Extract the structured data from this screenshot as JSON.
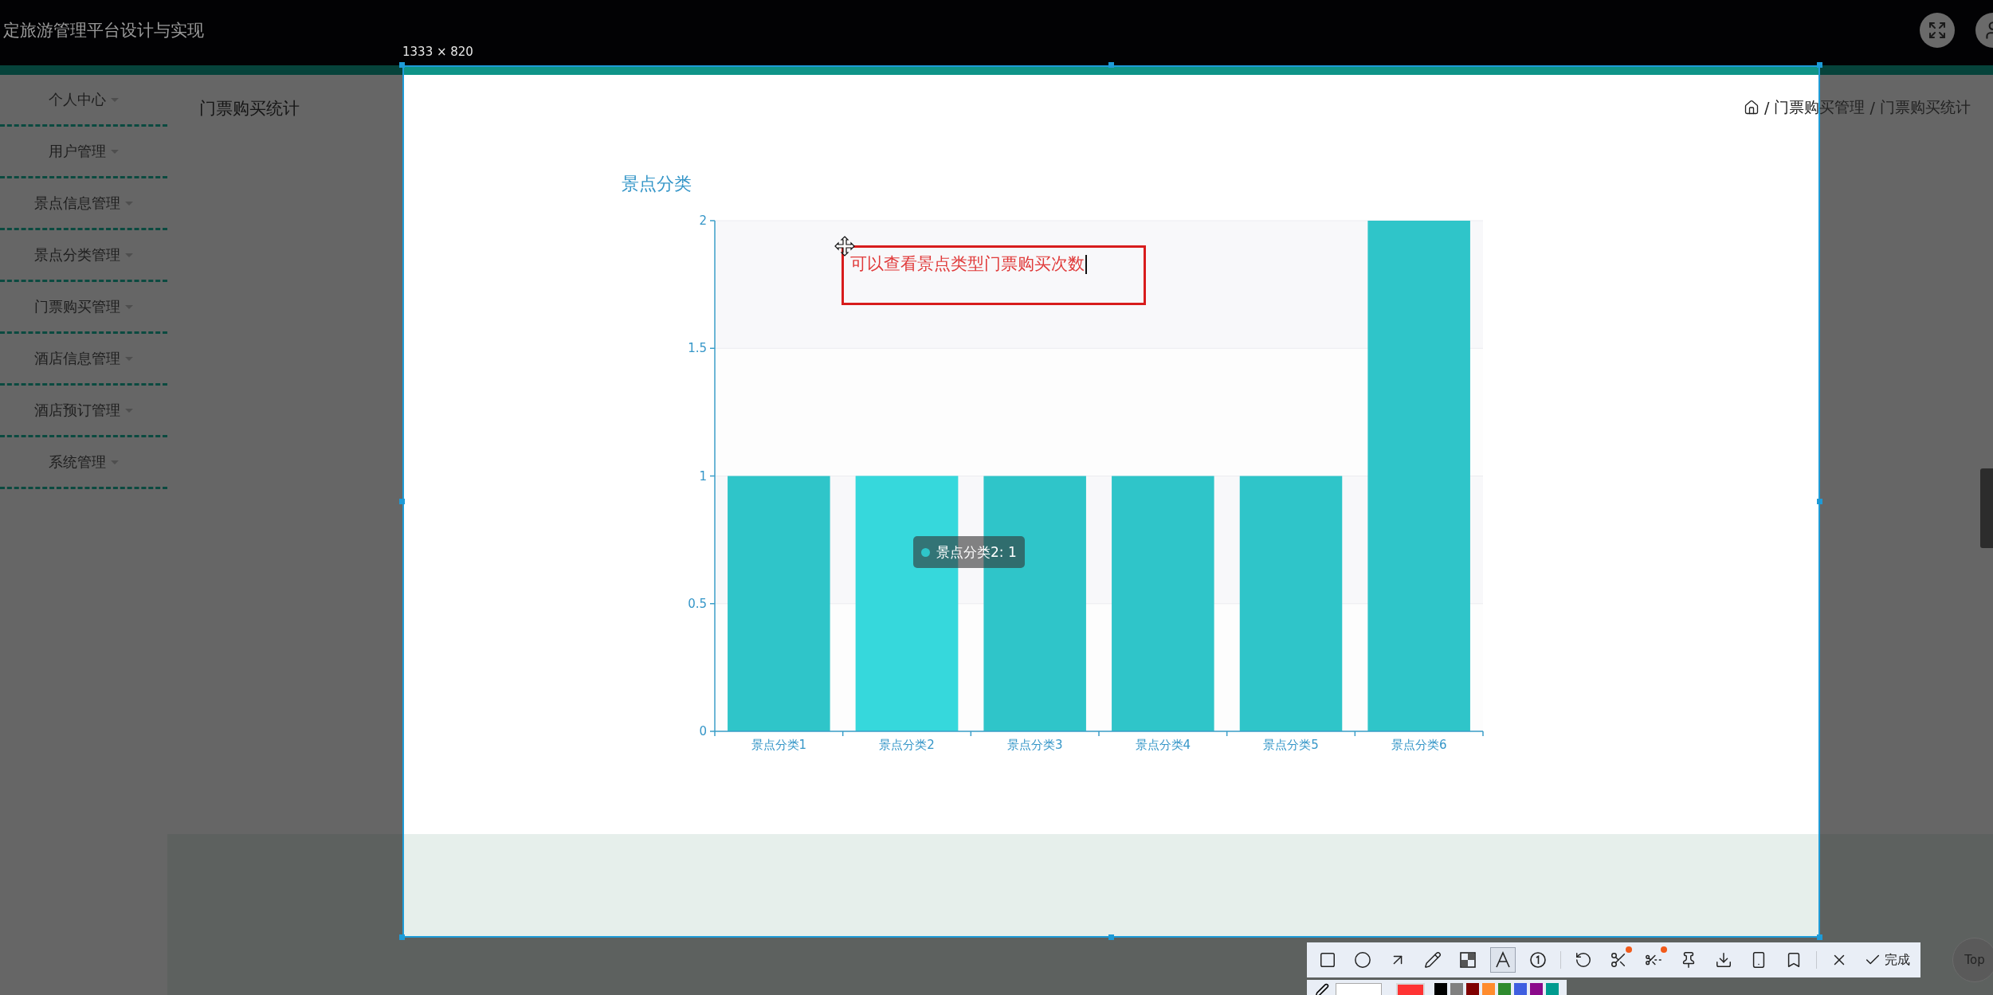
{
  "header": {
    "title": "定旅游管理平台设计与实现"
  },
  "sidebar": {
    "items": [
      {
        "label": "个人中心"
      },
      {
        "label": "用户管理"
      },
      {
        "label": "景点信息管理"
      },
      {
        "label": "景点分类管理"
      },
      {
        "label": "门票购买管理"
      },
      {
        "label": "酒店信息管理"
      },
      {
        "label": "酒店预订管理"
      },
      {
        "label": "系统管理"
      }
    ]
  },
  "page": {
    "title": "门票购买统计",
    "breadcrumb": [
      {
        "separator": "/",
        "label": "门票购买管理"
      },
      {
        "separator": "/",
        "label": "门票购买统计"
      }
    ]
  },
  "chart": {
    "title": "景点分类",
    "tooltip": "景点分类2: 1",
    "highlighted": [
      false,
      true,
      false,
      false,
      false,
      false
    ],
    "chart_data": {
      "type": "bar",
      "categories": [
        "景点分类1",
        "景点分类2",
        "景点分类3",
        "景点分类4",
        "景点分类5",
        "景点分类6"
      ],
      "series": [
        {
          "color": "#2fc5c9",
          "values": [
            1,
            1,
            1,
            1,
            1,
            2
          ]
        }
      ],
      "ylim": [
        0,
        2
      ],
      "yticks": [
        0,
        0.5,
        1,
        1.5,
        2
      ],
      "grid": true
    }
  },
  "capture": {
    "size_label": "1333 × 820",
    "annotation": "可以查看景点类型门票购买次数",
    "tools": [
      {
        "kind": "rect",
        "selected": false
      },
      {
        "kind": "circle",
        "selected": false
      },
      {
        "kind": "arrow",
        "selected": false
      },
      {
        "kind": "pencil",
        "selected": false
      },
      {
        "kind": "mosaic",
        "selected": false
      },
      {
        "kind": "text",
        "selected": true
      },
      {
        "kind": "number",
        "selected": false
      },
      {
        "kind": "undo",
        "selected": false
      },
      {
        "kind": "scissors",
        "selected": false,
        "notified": true
      },
      {
        "kind": "cutout",
        "selected": false,
        "notified": true
      },
      {
        "kind": "pin",
        "selected": false
      },
      {
        "kind": "download",
        "selected": false
      },
      {
        "kind": "phone",
        "selected": false
      },
      {
        "kind": "bookmark",
        "selected": false
      },
      {
        "kind": "close",
        "selected": false
      },
      {
        "kind": "confirm",
        "selected": false,
        "label": "完成"
      }
    ],
    "colors": [
      {
        "color": "#ff3333",
        "selected": true
      },
      {
        "color": "#000000",
        "selected": false
      },
      {
        "color": "#808080",
        "selected": false
      },
      {
        "color": "#800000",
        "selected": false
      },
      {
        "color": "#ff8c2e",
        "selected": false
      },
      {
        "color": "#2e8b2e",
        "selected": false
      },
      {
        "color": "#3f5fe0",
        "selected": false
      },
      {
        "color": "#8b0a8b",
        "selected": false
      },
      {
        "color": "#009b8f",
        "selected": false
      }
    ]
  },
  "back_to_top": {
    "label": "Top"
  }
}
